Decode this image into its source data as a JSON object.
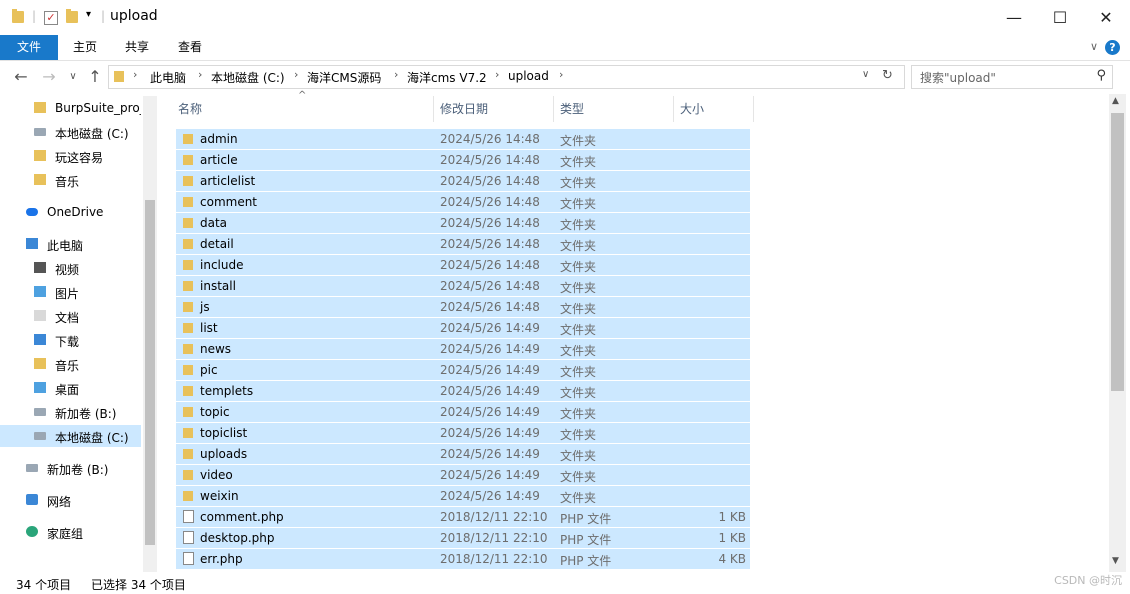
{
  "window": {
    "title": "upload",
    "minimize_icon": "minimize-icon",
    "maximize_icon": "maximize-icon",
    "close_icon": "close-icon"
  },
  "ribbon": {
    "tabs": [
      {
        "label": "文件",
        "active": true
      },
      {
        "label": "主页",
        "active": false
      },
      {
        "label": "共享",
        "active": false
      },
      {
        "label": "查看",
        "active": false
      }
    ],
    "accent": "#1979ca"
  },
  "address": {
    "crumbs": [
      "此电脑",
      "本地磁盘 (C:)",
      "海洋CMS源码",
      "海洋cms V7.2",
      "upload"
    ]
  },
  "search": {
    "placeholder": "搜索\"upload\""
  },
  "nav_pane": {
    "items": [
      {
        "label": "BurpSuite_pro_",
        "icon": "folder-icon"
      },
      {
        "label": "本地磁盘 (C:)",
        "icon": "drive-icon"
      },
      {
        "label": "玩这容易",
        "icon": "folder-icon"
      },
      {
        "label": "音乐",
        "icon": "music-icon"
      },
      {
        "label": "OneDrive",
        "icon": "onedrive-icon"
      },
      {
        "label": "此电脑",
        "icon": "pc-icon"
      },
      {
        "label": "视频",
        "icon": "video-icon"
      },
      {
        "label": "图片",
        "icon": "pictures-icon"
      },
      {
        "label": "文档",
        "icon": "documents-icon"
      },
      {
        "label": "下载",
        "icon": "downloads-icon"
      },
      {
        "label": "音乐",
        "icon": "music-icon"
      },
      {
        "label": "桌面",
        "icon": "desktop-icon"
      },
      {
        "label": "新加卷 (B:)",
        "icon": "drive-icon"
      },
      {
        "label": "本地磁盘 (C:)",
        "icon": "drive-icon"
      },
      {
        "label": "新加卷 (B:)",
        "icon": "drive-icon"
      },
      {
        "label": "网络",
        "icon": "network-icon"
      },
      {
        "label": "家庭组",
        "icon": "homegroup-icon"
      }
    ]
  },
  "columns": {
    "name": "名称",
    "date": "修改日期",
    "type": "类型",
    "size": "大小"
  },
  "files": [
    {
      "name": "admin",
      "date": "2024/5/26 14:48",
      "type": "文件夹",
      "size": "",
      "kind": "folder"
    },
    {
      "name": "article",
      "date": "2024/5/26 14:48",
      "type": "文件夹",
      "size": "",
      "kind": "folder"
    },
    {
      "name": "articlelist",
      "date": "2024/5/26 14:48",
      "type": "文件夹",
      "size": "",
      "kind": "folder"
    },
    {
      "name": "comment",
      "date": "2024/5/26 14:48",
      "type": "文件夹",
      "size": "",
      "kind": "folder"
    },
    {
      "name": "data",
      "date": "2024/5/26 14:48",
      "type": "文件夹",
      "size": "",
      "kind": "folder"
    },
    {
      "name": "detail",
      "date": "2024/5/26 14:48",
      "type": "文件夹",
      "size": "",
      "kind": "folder"
    },
    {
      "name": "include",
      "date": "2024/5/26 14:48",
      "type": "文件夹",
      "size": "",
      "kind": "folder"
    },
    {
      "name": "install",
      "date": "2024/5/26 14:48",
      "type": "文件夹",
      "size": "",
      "kind": "folder"
    },
    {
      "name": "js",
      "date": "2024/5/26 14:48",
      "type": "文件夹",
      "size": "",
      "kind": "folder"
    },
    {
      "name": "list",
      "date": "2024/5/26 14:49",
      "type": "文件夹",
      "size": "",
      "kind": "folder"
    },
    {
      "name": "news",
      "date": "2024/5/26 14:49",
      "type": "文件夹",
      "size": "",
      "kind": "folder"
    },
    {
      "name": "pic",
      "date": "2024/5/26 14:49",
      "type": "文件夹",
      "size": "",
      "kind": "folder"
    },
    {
      "name": "templets",
      "date": "2024/5/26 14:49",
      "type": "文件夹",
      "size": "",
      "kind": "folder"
    },
    {
      "name": "topic",
      "date": "2024/5/26 14:49",
      "type": "文件夹",
      "size": "",
      "kind": "folder"
    },
    {
      "name": "topiclist",
      "date": "2024/5/26 14:49",
      "type": "文件夹",
      "size": "",
      "kind": "folder"
    },
    {
      "name": "uploads",
      "date": "2024/5/26 14:49",
      "type": "文件夹",
      "size": "",
      "kind": "folder"
    },
    {
      "name": "video",
      "date": "2024/5/26 14:49",
      "type": "文件夹",
      "size": "",
      "kind": "folder"
    },
    {
      "name": "weixin",
      "date": "2024/5/26 14:49",
      "type": "文件夹",
      "size": "",
      "kind": "folder"
    },
    {
      "name": "comment.php",
      "date": "2018/12/11 22:10",
      "type": "PHP 文件",
      "size": "1 KB",
      "kind": "file"
    },
    {
      "name": "desktop.php",
      "date": "2018/12/11 22:10",
      "type": "PHP 文件",
      "size": "1 KB",
      "kind": "file"
    },
    {
      "name": "err.php",
      "date": "2018/12/11 22:10",
      "type": "PHP 文件",
      "size": "4 KB",
      "kind": "file"
    }
  ],
  "status": {
    "count": "34 个项目",
    "selected": "已选择 34 个项目"
  },
  "watermark": "CSDN @时沉"
}
